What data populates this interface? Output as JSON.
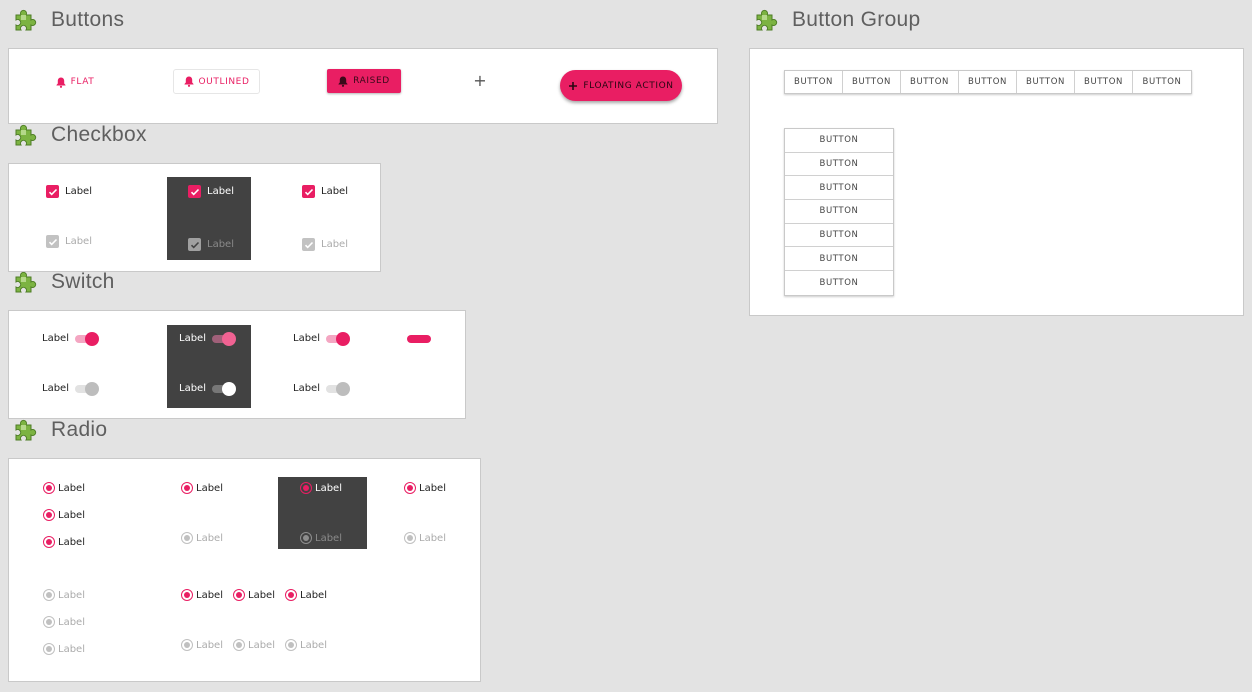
{
  "colors": {
    "accent": "#e91e63",
    "panel": "#ffffff",
    "dark_panel": "#424242",
    "background": "#e3e3e3"
  },
  "sections": {
    "buttons": {
      "title": "Buttons",
      "icon": "puzzle-icon"
    },
    "checkbox": {
      "title": "Checkbox",
      "icon": "puzzle-icon"
    },
    "switch": {
      "title": "Switch",
      "icon": "puzzle-icon"
    },
    "radio": {
      "title": "Radio",
      "icon": "puzzle-icon"
    },
    "button_group": {
      "title": "Button Group",
      "icon": "puzzle-icon"
    }
  },
  "buttons": {
    "flat": {
      "label": "FLAT",
      "icon": "bell-icon"
    },
    "outlined": {
      "label": "OUTLINED",
      "icon": "bell-icon"
    },
    "raised": {
      "label": "RAISED",
      "icon": "bell-icon"
    },
    "plus": {
      "label": "+"
    },
    "fab": {
      "label": "FLOATING ACTION",
      "icon": "plus-icon"
    }
  },
  "button_group": {
    "horizontal": [
      "BUTTON",
      "BUTTON",
      "BUTTON",
      "BUTTON",
      "BUTTON",
      "BUTTON",
      "BUTTON"
    ],
    "vertical": [
      "BUTTON",
      "BUTTON",
      "BUTTON",
      "BUTTON",
      "BUTTON",
      "BUTTON",
      "BUTTON"
    ]
  },
  "checkbox": {
    "label": "Label"
  },
  "switch": {
    "label": "Label"
  },
  "radio": {
    "label": "Label"
  }
}
